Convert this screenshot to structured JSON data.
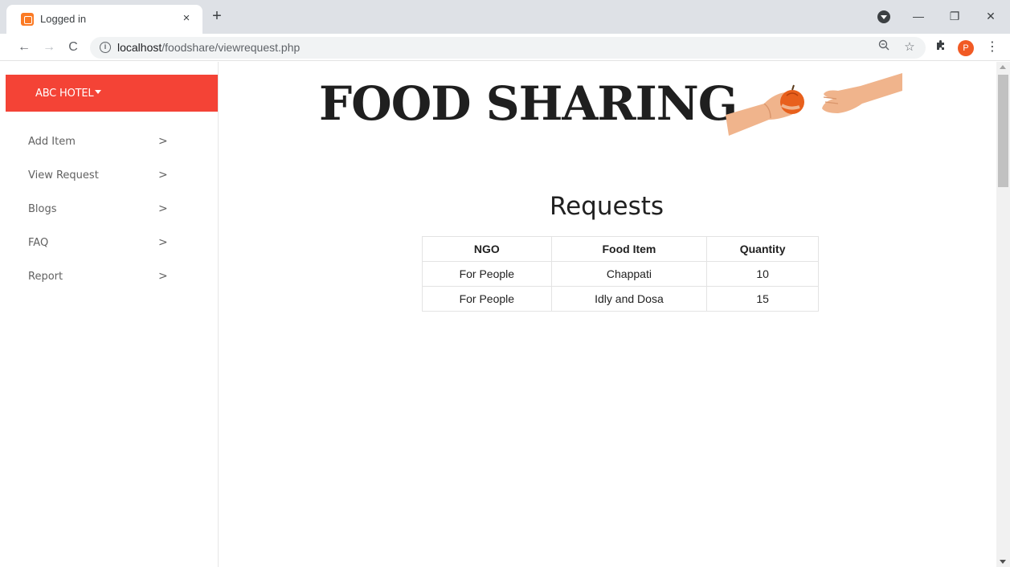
{
  "browser": {
    "tab_title": "Logged in",
    "tab_close": "×",
    "new_tab": "+",
    "url_host": "localhost",
    "url_path": "/foodshare/viewrequest.php",
    "back": "←",
    "forward": "→",
    "reload": "C",
    "zoom_icon": "zoom-icon",
    "bookmark": "☆",
    "extensions": "puzzle-icon",
    "profile_initial": "P",
    "menu": "⋮",
    "minimize": "—",
    "restore": "❐",
    "close": "✕"
  },
  "sidebar": {
    "brand": "ABC HOTEL",
    "items": [
      {
        "label": "Add Item"
      },
      {
        "label": "View Request"
      },
      {
        "label": "Blogs"
      },
      {
        "label": "FAQ"
      },
      {
        "label": "Report"
      }
    ],
    "chevron": ">"
  },
  "header": {
    "logo_text": "FOOD SHARING"
  },
  "main": {
    "heading": "Requests",
    "table": {
      "columns": [
        "NGO",
        "Food Item",
        "Quantity"
      ],
      "rows": [
        [
          "For People",
          "Chappati",
          "10"
        ],
        [
          "For People",
          "Idly and Dosa",
          "15"
        ]
      ]
    }
  },
  "colors": {
    "brand": "#f44336",
    "tab_favicon": "#fb7a24",
    "avatar": "#f15a24"
  }
}
